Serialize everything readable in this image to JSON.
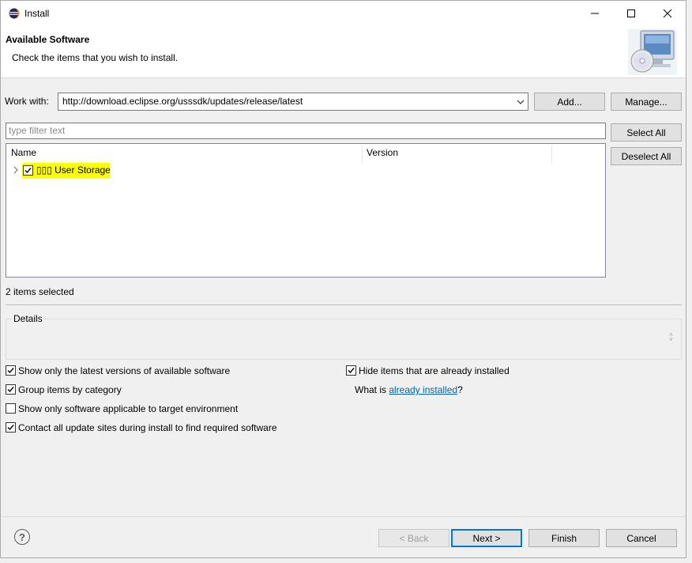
{
  "window": {
    "title": "Install"
  },
  "header": {
    "title": "Available Software",
    "description": "Check the items that you wish to install.",
    "graphic_icon": "computer-cd-icon"
  },
  "work_with": {
    "label": "Work with:",
    "value": "http://download.eclipse.org/usssdk/updates/release/latest",
    "add_label": "Add...",
    "manage_label": "Manage..."
  },
  "filter": {
    "placeholder": "type filter text"
  },
  "selection": {
    "select_all_label": "Select All",
    "deselect_all_label": "Deselect All"
  },
  "tree": {
    "columns": [
      "Name",
      "Version"
    ],
    "items": [
      {
        "label": "▯▯▯ User Storage",
        "version": "",
        "checked": true,
        "highlight": "#ffff00"
      }
    ]
  },
  "status": {
    "selected_text": "2 items selected"
  },
  "details": {
    "label": "Details"
  },
  "options": {
    "latest_versions": {
      "label": "Show only the latest versions of available software",
      "checked": true
    },
    "group_by_category": {
      "label": "Group items by category",
      "checked": true
    },
    "target_env": {
      "label": "Show only software applicable to target environment",
      "checked": false
    },
    "contact_sites": {
      "label": "Contact all update sites during install to find required software",
      "checked": true
    },
    "hide_installed": {
      "label": "Hide items that are already installed",
      "checked": true
    },
    "what_is_prefix": "What is ",
    "what_is_link": "already installed",
    "what_is_suffix": "?"
  },
  "footer": {
    "help_label": "?",
    "back_label": "< Back",
    "next_label": "Next >",
    "finish_label": "Finish",
    "cancel_label": "Cancel"
  },
  "colors": {
    "accent": "#0078d7",
    "link": "#0063b1",
    "highlight": "#ffff00"
  }
}
